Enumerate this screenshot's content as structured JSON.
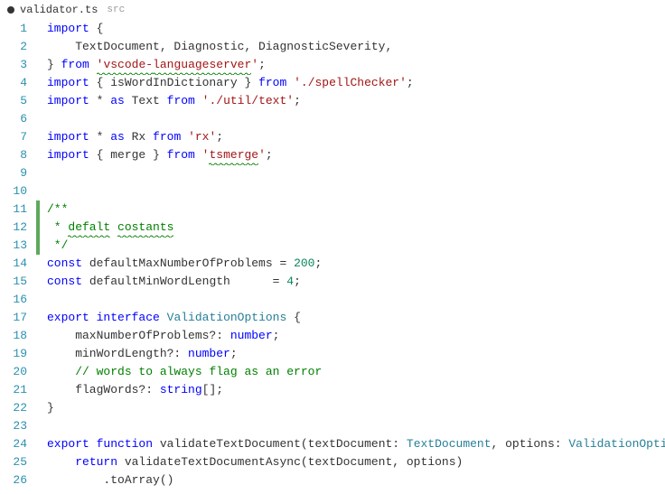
{
  "tab": {
    "modified": true,
    "filename": "validator.ts",
    "src_label": "src"
  },
  "gutter": {
    "start": 1,
    "end": 26
  },
  "diff_added_lines": [
    11,
    12,
    13
  ],
  "code_lines": [
    [
      {
        "t": "kw",
        "v": "import"
      },
      {
        "t": "pl",
        "v": " {"
      }
    ],
    [
      {
        "t": "pl",
        "v": "    TextDocument, Diagnostic, DiagnosticSeverity,"
      }
    ],
    [
      {
        "t": "pl",
        "v": "} "
      },
      {
        "t": "kw",
        "v": "from"
      },
      {
        "t": "pl",
        "v": " "
      },
      {
        "t": "str",
        "v": "'vscode-",
        "sq": true
      },
      {
        "t": "str",
        "v": "languageserver",
        "sq": true
      },
      {
        "t": "str",
        "v": "'"
      },
      {
        "t": "pl",
        "v": ";"
      }
    ],
    [
      {
        "t": "kw",
        "v": "import"
      },
      {
        "t": "pl",
        "v": " { "
      },
      {
        "t": "pl",
        "v": "isWordInDictionary"
      },
      {
        "t": "pl",
        "v": " } "
      },
      {
        "t": "kw",
        "v": "from"
      },
      {
        "t": "pl",
        "v": " "
      },
      {
        "t": "str",
        "v": "'./spellChecker'"
      },
      {
        "t": "pl",
        "v": ";"
      }
    ],
    [
      {
        "t": "kw",
        "v": "import"
      },
      {
        "t": "pl",
        "v": " * "
      },
      {
        "t": "kw",
        "v": "as"
      },
      {
        "t": "pl",
        "v": " Text "
      },
      {
        "t": "kw",
        "v": "from"
      },
      {
        "t": "pl",
        "v": " "
      },
      {
        "t": "str",
        "v": "'./util/text'"
      },
      {
        "t": "pl",
        "v": ";"
      }
    ],
    [],
    [
      {
        "t": "kw",
        "v": "import"
      },
      {
        "t": "pl",
        "v": " * "
      },
      {
        "t": "kw",
        "v": "as"
      },
      {
        "t": "pl",
        "v": " Rx "
      },
      {
        "t": "kw",
        "v": "from"
      },
      {
        "t": "pl",
        "v": " "
      },
      {
        "t": "str",
        "v": "'rx'"
      },
      {
        "t": "pl",
        "v": ";"
      }
    ],
    [
      {
        "t": "kw",
        "v": "import"
      },
      {
        "t": "pl",
        "v": " { merge } "
      },
      {
        "t": "kw",
        "v": "from"
      },
      {
        "t": "pl",
        "v": " "
      },
      {
        "t": "str",
        "v": "'",
        "sq": false
      },
      {
        "t": "str",
        "v": "tsmerge",
        "sq": true
      },
      {
        "t": "str",
        "v": "'"
      },
      {
        "t": "pl",
        "v": ";"
      }
    ],
    [],
    [],
    [
      {
        "t": "comment",
        "v": "/**"
      }
    ],
    [
      {
        "t": "comment",
        "v": " * "
      },
      {
        "t": "comment",
        "v": "defalt",
        "sq": true
      },
      {
        "t": "comment",
        "v": " "
      },
      {
        "t": "comment",
        "v": "costants",
        "sq": true
      }
    ],
    [
      {
        "t": "comment",
        "v": " */"
      }
    ],
    [
      {
        "t": "kw",
        "v": "const"
      },
      {
        "t": "pl",
        "v": " defaultMaxNumberOfProblems = "
      },
      {
        "t": "num",
        "v": "200"
      },
      {
        "t": "pl",
        "v": ";"
      }
    ],
    [
      {
        "t": "kw",
        "v": "const"
      },
      {
        "t": "pl",
        "v": " defaultMinWordLength      = "
      },
      {
        "t": "num",
        "v": "4"
      },
      {
        "t": "pl",
        "v": ";"
      }
    ],
    [],
    [
      {
        "t": "kw",
        "v": "export"
      },
      {
        "t": "pl",
        "v": " "
      },
      {
        "t": "kw",
        "v": "interface"
      },
      {
        "t": "pl",
        "v": " "
      },
      {
        "t": "type",
        "v": "ValidationOptions"
      },
      {
        "t": "pl",
        "v": " {"
      }
    ],
    [
      {
        "t": "pl",
        "v": "    maxNumberOfProblems?: "
      },
      {
        "t": "kw",
        "v": "number"
      },
      {
        "t": "pl",
        "v": ";"
      }
    ],
    [
      {
        "t": "pl",
        "v": "    minWordLength?: "
      },
      {
        "t": "kw",
        "v": "number"
      },
      {
        "t": "pl",
        "v": ";"
      }
    ],
    [
      {
        "t": "pl",
        "v": "    "
      },
      {
        "t": "comment",
        "v": "// words to always flag as an error"
      }
    ],
    [
      {
        "t": "pl",
        "v": "    flagWords?: "
      },
      {
        "t": "kw",
        "v": "string"
      },
      {
        "t": "pl",
        "v": "[];"
      }
    ],
    [
      {
        "t": "pl",
        "v": "}"
      }
    ],
    [],
    [
      {
        "t": "kw",
        "v": "export"
      },
      {
        "t": "pl",
        "v": " "
      },
      {
        "t": "kw",
        "v": "function"
      },
      {
        "t": "pl",
        "v": " validateTextDocument(textDocument: "
      },
      {
        "t": "type",
        "v": "TextDocument"
      },
      {
        "t": "pl",
        "v": ", options: "
      },
      {
        "t": "type",
        "v": "ValidationOpti"
      }
    ],
    [
      {
        "t": "pl",
        "v": "    "
      },
      {
        "t": "kw",
        "v": "return"
      },
      {
        "t": "pl",
        "v": " validateTextDocumentAsync(textDocument, options)"
      }
    ],
    [
      {
        "t": "pl",
        "v": "        .toArray()"
      }
    ]
  ]
}
